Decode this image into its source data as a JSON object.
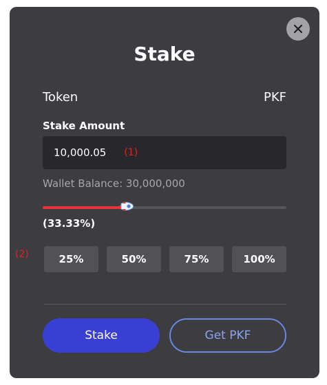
{
  "dialog": {
    "title": "Stake",
    "close_label": "×"
  },
  "token": {
    "label": "Token",
    "value": "PKF"
  },
  "stake_amount": {
    "label": "Stake Amount",
    "value": "10,000.05",
    "annotation": "(1)"
  },
  "wallet_balance": "Wallet Balance: 30,000,000",
  "slider": {
    "percent": 33.33,
    "percent_label": "(33.33%)",
    "thumb_icon": "rocket-icon",
    "fill_color": "#e8333a"
  },
  "quick_select": {
    "annotation": "(2)",
    "options": [
      "25%",
      "50%",
      "75%",
      "100%"
    ]
  },
  "actions": {
    "stake_label": "Stake",
    "get_label": "Get PKF"
  },
  "colors": {
    "modal_bg": "#3c3c41",
    "primary": "#3a3fd4",
    "annotation": "#e02323"
  }
}
